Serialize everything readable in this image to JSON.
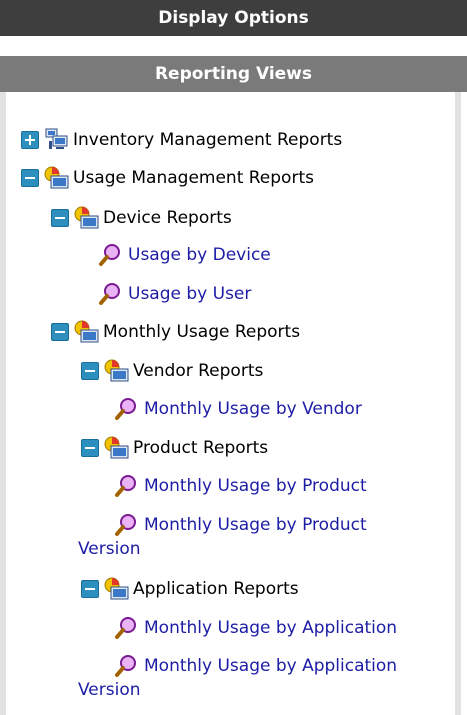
{
  "header": {
    "display_options": "Display Options",
    "reporting_views": "Reporting Views"
  },
  "tree": {
    "inventory": "Inventory Management Reports",
    "usage": "Usage Management Reports",
    "device_reports": "Device Reports",
    "usage_by_device": "Usage by Device",
    "usage_by_user": "Usage by User",
    "monthly_usage": "Monthly Usage Reports",
    "vendor_reports": "Vendor Reports",
    "monthly_by_vendor": "Monthly Usage by Vendor",
    "product_reports": "Product Reports",
    "monthly_by_product": "Monthly Usage by Product",
    "monthly_by_product_version_1": "Monthly Usage by Product",
    "monthly_by_product_version_2": "Version",
    "application_reports": "Application Reports",
    "monthly_by_application": "Monthly Usage by Application",
    "monthly_by_application_version_1": "Monthly Usage by Application",
    "monthly_by_application_version_2": "Version"
  }
}
